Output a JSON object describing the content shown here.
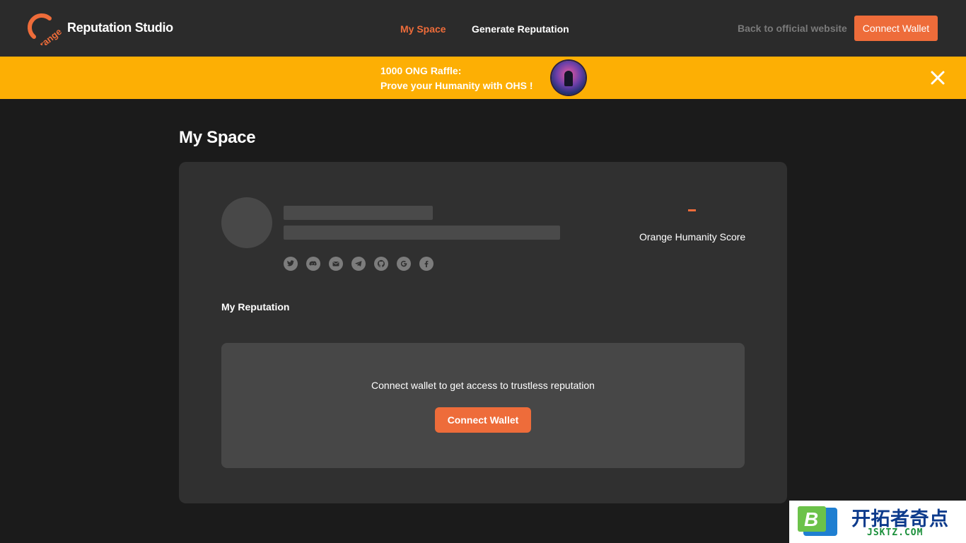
{
  "header": {
    "brand": "Reputation Studio",
    "logo_text": "range",
    "nav": [
      "My Space",
      "Generate Reputation"
    ],
    "back_link": "Back to official website",
    "connect_button": "Connect Wallet",
    "accent_color": "#ee6c3a"
  },
  "banner": {
    "line1": "1000 ONG Raffle:",
    "line2": "Prove your Humanity with OHS !",
    "background": "#fdaf04",
    "close_icon": "close-icon"
  },
  "page": {
    "title": "My Space",
    "profile": {
      "social_icons": [
        "twitter-icon",
        "discord-icon",
        "mail-icon",
        "telegram-icon",
        "github-icon",
        "google-icon",
        "facebook-icon"
      ],
      "score_value": "-",
      "score_label": "Orange Humanity Score"
    },
    "reputation": {
      "title": "My Reputation",
      "message": "Connect wallet to get access to trustless reputation",
      "connect_button": "Connect Wallet"
    }
  },
  "watermark": {
    "badge": "B",
    "name": "开拓者奇点",
    "domain": "JSKTZ.COM"
  }
}
